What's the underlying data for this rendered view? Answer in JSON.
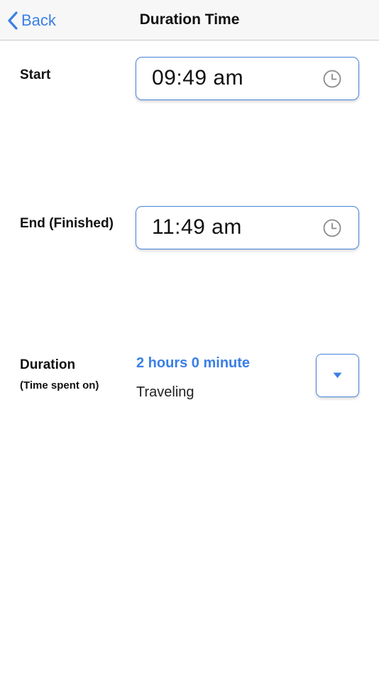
{
  "nav": {
    "back_label": "Back",
    "title": "Duration Time"
  },
  "start": {
    "label": "Start",
    "value": "09:49 am",
    "icon": "clock-icon"
  },
  "end": {
    "label": "End (Finished)",
    "value": "11:49 am",
    "icon": "clock-icon"
  },
  "duration": {
    "label": "Duration",
    "sublabel": "(Time spent on)",
    "value": "2 hours 0 minute",
    "activity": "Traveling",
    "dropdown_icon": "caret-down-icon"
  },
  "colors": {
    "accent": "#3a7fe6",
    "border": "#4a86e0",
    "nav_bg": "#f7f7f7"
  }
}
